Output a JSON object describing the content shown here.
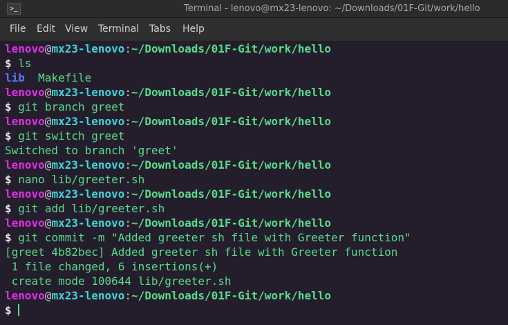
{
  "window": {
    "title": "Terminal - lenovo@mx23-lenovo: ~/Downloads/01F-Git/work/hello",
    "icon": "terminal-icon"
  },
  "menu": [
    "File",
    "Edit",
    "View",
    "Terminal",
    "Tabs",
    "Help"
  ],
  "prompt": {
    "user": "lenovo",
    "at": "@",
    "host": "mx23-lenovo",
    "colon": ":",
    "path": "~/Downloads/01F-Git/work/hello",
    "dollar": "$"
  },
  "commands": [
    "ls",
    "git branch greet",
    "git switch greet",
    "nano lib/greeter.sh",
    "git add lib/greeter.sh",
    "git commit -m \"Added greeter sh file with Greeter function\""
  ],
  "ls_output": {
    "dir": "lib",
    "file": "Makefile"
  },
  "outputs": {
    "switch": "Switched to branch 'greet'",
    "commit": [
      "[greet 4b82bec] Added greeter sh file with Greeter function",
      " 1 file changed, 6 insertions(+)",
      " create mode 100644 lib/greeter.sh"
    ]
  },
  "colors": {
    "user": "#e02de6",
    "host": "#3ed5d8",
    "path": "#58dc8b",
    "directory": "#5577f2",
    "background": "#241e2c"
  }
}
